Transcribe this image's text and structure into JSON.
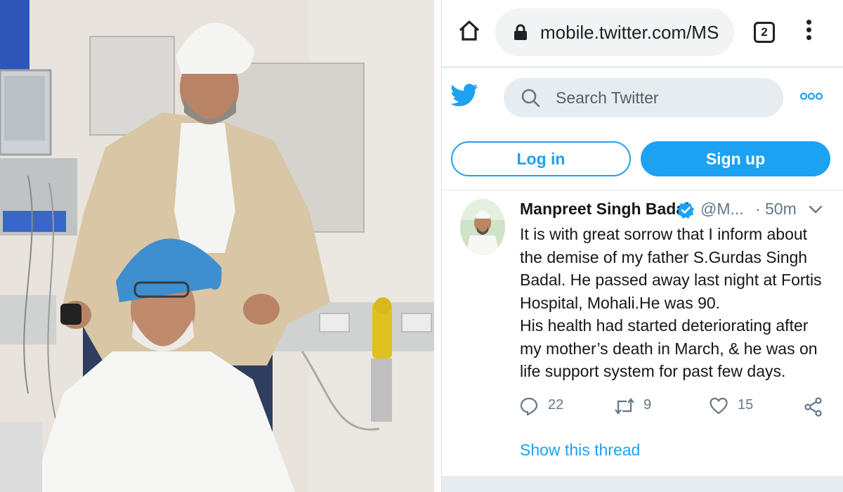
{
  "browser": {
    "url": "mobile.twitter.com/MS",
    "tab_count": "2"
  },
  "twitter": {
    "search_placeholder": "Search Twitter",
    "login_label": "Log in",
    "signup_label": "Sign up",
    "accent_color": "#1da1f2"
  },
  "tweet": {
    "display_name": "Manpreet Singh Badal",
    "handle": "@M...",
    "separator": "·",
    "time": "50m",
    "body_lines": [
      "It is with great sorrow that I inform about",
      "the demise of my father S.Gurdas Singh",
      "Badal. He passed away last night at Fortis",
      "Hospital, Mohali.He was 90.",
      "His health had started deteriorating after",
      "my mother’s death in March, &  he was on",
      "life support system for past few days."
    ],
    "replies": "22",
    "retweets": "9",
    "likes": "15",
    "show_thread": "Show this thread"
  },
  "icons": [
    "home-icon",
    "lock-icon",
    "tabs-icon",
    "more-vert-icon",
    "twitter-bird-icon",
    "search-icon",
    "more-horiz-icon",
    "verified-badge-icon",
    "chevron-down-icon",
    "reply-icon",
    "retweet-icon",
    "like-icon",
    "share-icon"
  ]
}
